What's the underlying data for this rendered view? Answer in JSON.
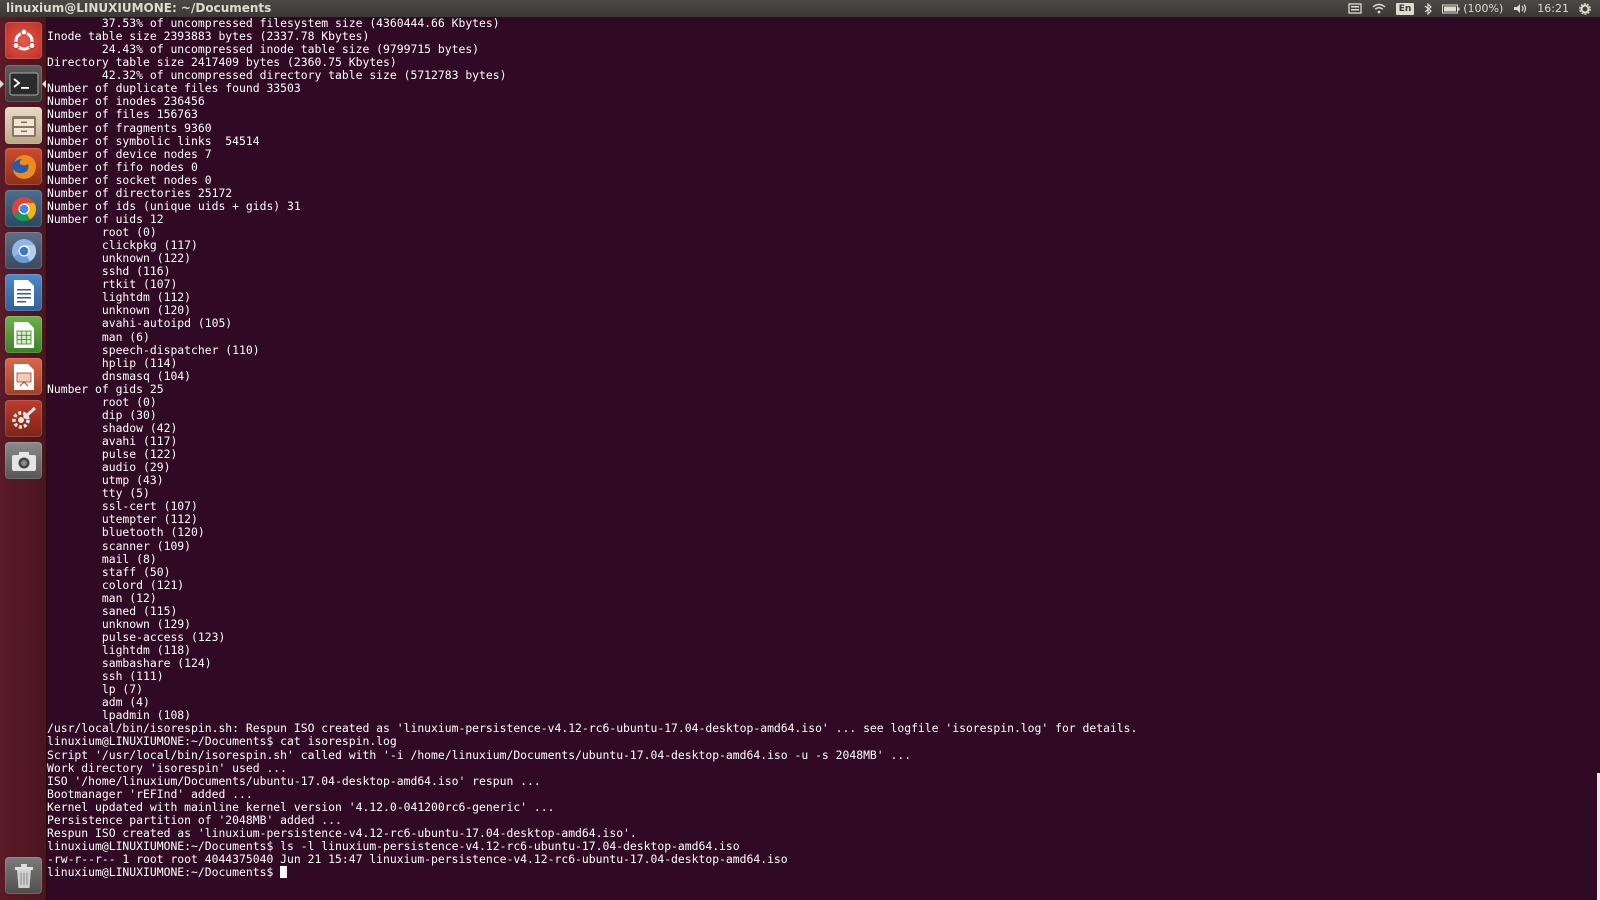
{
  "window": {
    "title": "linuxium@LINUXIUMONE: ~/Documents"
  },
  "panel": {
    "keyboard_layout": "En",
    "battery": "(100%)",
    "clock": "16:21"
  },
  "launcher": {
    "items": [
      {
        "name": "dash-home",
        "icon": "ubuntu-logo-icon"
      },
      {
        "name": "terminal",
        "icon": "terminal-icon",
        "active": true
      },
      {
        "name": "files",
        "icon": "file-cabinet-icon"
      },
      {
        "name": "firefox",
        "icon": "firefox-icon"
      },
      {
        "name": "chrome",
        "icon": "chrome-icon"
      },
      {
        "name": "chromium",
        "icon": "chromium-icon"
      },
      {
        "name": "writer",
        "icon": "writer-document-icon"
      },
      {
        "name": "calc",
        "icon": "calc-spreadsheet-icon"
      },
      {
        "name": "impress",
        "icon": "impress-presentation-icon"
      },
      {
        "name": "system-settings",
        "icon": "settings-wrench-icon"
      },
      {
        "name": "camera",
        "icon": "camera-icon"
      },
      {
        "name": "trash",
        "icon": "trash-icon"
      }
    ]
  },
  "terminal": {
    "lines": [
      "        37.53% of uncompressed filesystem size (4360444.66 Kbytes)",
      "Inode table size 2393883 bytes (2337.78 Kbytes)",
      "        24.43% of uncompressed inode table size (9799715 bytes)",
      "Directory table size 2417409 bytes (2360.75 Kbytes)",
      "        42.32% of uncompressed directory table size (5712783 bytes)",
      "Number of duplicate files found 33503",
      "Number of inodes 236456",
      "Number of files 156763",
      "Number of fragments 9360",
      "Number of symbolic links  54514",
      "Number of device nodes 7",
      "Number of fifo nodes 0",
      "Number of socket nodes 0",
      "Number of directories 25172",
      "Number of ids (unique uids + gids) 31",
      "Number of uids 12",
      "        root (0)",
      "        clickpkg (117)",
      "        unknown (122)",
      "        sshd (116)",
      "        rtkit (107)",
      "        lightdm (112)",
      "        unknown (120)",
      "        avahi-autoipd (105)",
      "        man (6)",
      "        speech-dispatcher (110)",
      "        hplip (114)",
      "        dnsmasq (104)",
      "Number of gids 25",
      "        root (0)",
      "        dip (30)",
      "        shadow (42)",
      "        avahi (117)",
      "        pulse (122)",
      "        audio (29)",
      "        utmp (43)",
      "        tty (5)",
      "        ssl-cert (107)",
      "        utempter (112)",
      "        bluetooth (120)",
      "        scanner (109)",
      "        mail (8)",
      "        staff (50)",
      "        colord (121)",
      "        man (12)",
      "        saned (115)",
      "        unknown (129)",
      "        pulse-access (123)",
      "        lightdm (118)",
      "        sambashare (124)",
      "        ssh (111)",
      "        lp (7)",
      "        adm (4)",
      "        lpadmin (108)",
      "/usr/local/bin/isorespin.sh: Respun ISO created as 'linuxium-persistence-v4.12-rc6-ubuntu-17.04-desktop-amd64.iso' ... see logfile 'isorespin.log' for details.",
      "linuxium@LINUXIUMONE:~/Documents$ cat isorespin.log",
      "Script '/usr/local/bin/isorespin.sh' called with '-i /home/linuxium/Documents/ubuntu-17.04-desktop-amd64.iso -u -s 2048MB' ...",
      "Work directory 'isorespin' used ...",
      "ISO '/home/linuxium/Documents/ubuntu-17.04-desktop-amd64.iso' respun ...",
      "Bootmanager 'rEFInd' added ...",
      "Kernel updated with mainline kernel version '4.12.0-041200rc6-generic' ...",
      "Persistence partition of '2048MB' added ...",
      "Respun ISO created as 'linuxium-persistence-v4.12-rc6-ubuntu-17.04-desktop-amd64.iso'.",
      "linuxium@LINUXIUMONE:~/Documents$ ls -l linuxium-persistence-v4.12-rc6-ubuntu-17.04-desktop-amd64.iso",
      "-rw-r--r-- 1 root root 4044375040 Jun 21 15:47 linuxium-persistence-v4.12-rc6-ubuntu-17.04-desktop-amd64.iso"
    ],
    "prompt": "linuxium@LINUXIUMONE:~/Documents$ "
  },
  "colors": {
    "terminal_bg": "#300a24",
    "terminal_fg": "#ffffff",
    "panel_bg": "#3a3935",
    "launcher_bg": "#5a1a27"
  }
}
